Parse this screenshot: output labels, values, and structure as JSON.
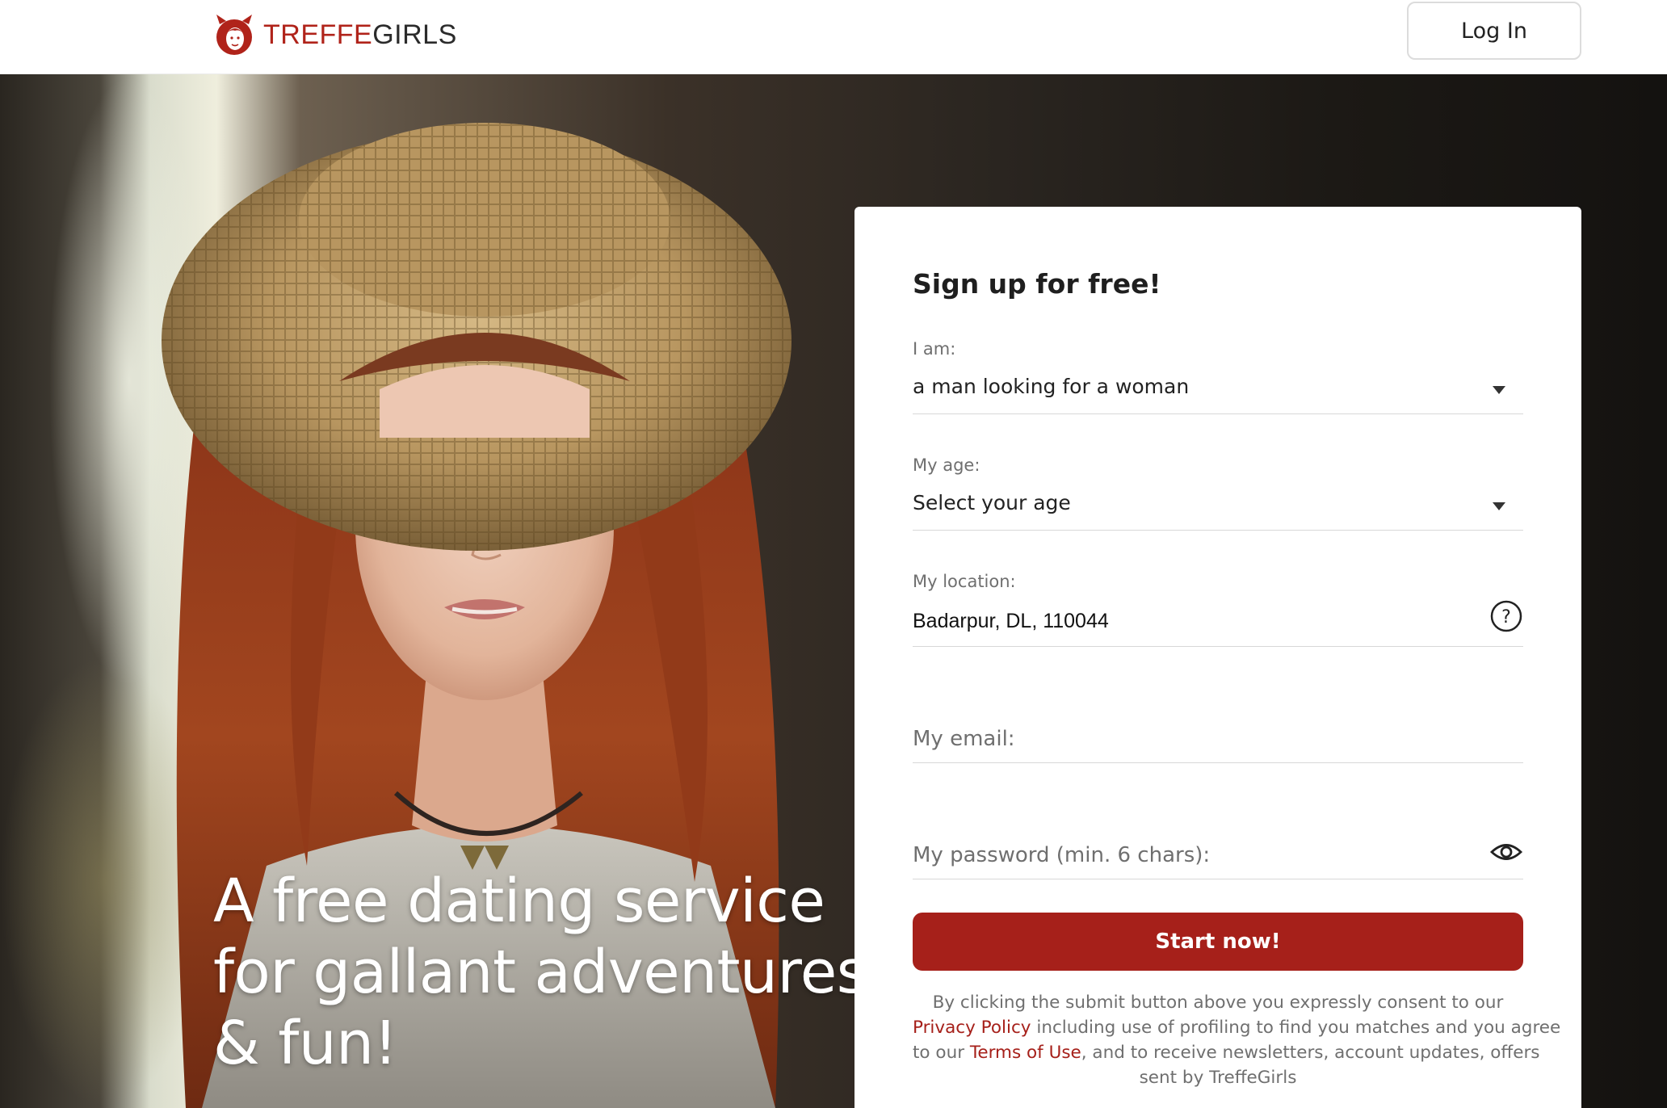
{
  "header": {
    "logo_word1": "TREFFE",
    "logo_word2": "GIRLS",
    "login_label": "Log In"
  },
  "hero": {
    "headline_lines": [
      "A free dating service",
      "for gallant adventures",
      "& fun!"
    ]
  },
  "signup": {
    "title": "Sign up for free!",
    "iam_label": "I am:",
    "iam_value": "a man looking for a woman",
    "age_label": "My age:",
    "age_value": "Select your age",
    "location_label": "My location:",
    "location_value": "Badarpur, DL, 110044",
    "email_placeholder": "My email:",
    "password_placeholder": "My password (min. 6 chars):",
    "submit_label": "Start now!",
    "consent": {
      "line1": "By clicking the submit button above you expressly consent to our",
      "privacy_link": "Privacy Policy",
      "line2_rest": " including use of profiling to find you matches and you agree",
      "line3_prefix": "to our ",
      "terms_link": "Terms of Use",
      "line3_rest": ", and to receive newsletters, account updates, offers",
      "line4": "sent by TreffeGirls"
    }
  },
  "icons": {
    "logo": "devil-girl-logo-icon",
    "iam_dropdown": "chevron-down-icon",
    "age_dropdown": "chevron-down-icon",
    "location_help": "question-circle-icon",
    "password_toggle": "eye-icon"
  },
  "colors": {
    "brand_red": "#a6201a",
    "text_dark": "#222222",
    "text_muted": "#6f6f6f"
  }
}
